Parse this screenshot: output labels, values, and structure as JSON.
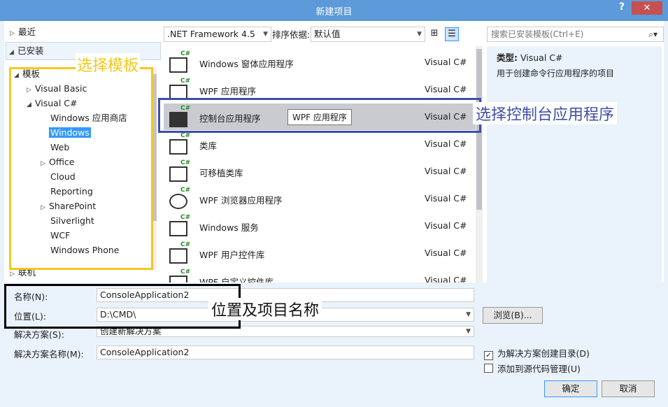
{
  "window": {
    "title": "新建项目",
    "help": "?",
    "close": "✕"
  },
  "tree": {
    "recent": "最近",
    "installed": "已安装",
    "templates": "模板",
    "items": [
      {
        "label": "Visual Basic"
      },
      {
        "label": "Visual C#"
      },
      {
        "label": "Windows 应用商店"
      },
      {
        "label": "Windows"
      },
      {
        "label": "Web"
      },
      {
        "label": "Office"
      },
      {
        "label": "Cloud"
      },
      {
        "label": "Reporting"
      },
      {
        "label": "SharePoint"
      },
      {
        "label": "Silverlight"
      },
      {
        "label": "WCF"
      },
      {
        "label": "Windows Phone"
      }
    ],
    "online": "联机"
  },
  "toolbar": {
    "framework": ".NET Framework 4.5",
    "sort_label": "排序依据:",
    "sort_value": "默认值",
    "search_placeholder": "搜索已安装模板(Ctrl+E)"
  },
  "templates": [
    {
      "name": "Windows 窗体应用程序",
      "lang": "Visual C#"
    },
    {
      "name": "WPF 应用程序",
      "lang": "Visual C#"
    },
    {
      "name": "控制台应用程序",
      "lang": "Visual C#"
    },
    {
      "name": "类库",
      "lang": "Visual C#"
    },
    {
      "name": "可移植类库",
      "lang": "Visual C#"
    },
    {
      "name": "WPF 浏览器应用程序",
      "lang": "Visual C#"
    },
    {
      "name": "Windows 服务",
      "lang": "Visual C#"
    },
    {
      "name": "WPF 用户控件库",
      "lang": "Visual C#"
    },
    {
      "name": "WPF 自定义控件库",
      "lang": "Visual C#"
    }
  ],
  "tooltip": "WPF 应用程序",
  "info": {
    "type_label": "类型:",
    "type_value": "Visual C#",
    "description": "用于创建命令行应用程序的项目"
  },
  "form": {
    "name_label": "名称(N):",
    "name_value": "ConsoleApplication2",
    "location_label": "位置(L):",
    "location_value": "D:\\CMD\\",
    "solution_label": "解决方案(S):",
    "solution_value": "创建新解决方案",
    "solution_name_label": "解决方案名称(M):",
    "solution_name_value": "ConsoleApplication2",
    "browse": "浏览(B)...",
    "create_dir": "为解决方案创建目录(D)",
    "add_source": "添加到源代码管理(U)",
    "ok": "确定",
    "cancel": "取消"
  },
  "annotations": {
    "template": "选择模板",
    "console": "选择控制台应用程序",
    "location": "位置及项目名称"
  },
  "colors": {
    "titlebar": "#5c9ad9",
    "selection": "#3399ff",
    "annot_yellow": "#f3c81d",
    "annot_blue": "#3e4fa8"
  }
}
